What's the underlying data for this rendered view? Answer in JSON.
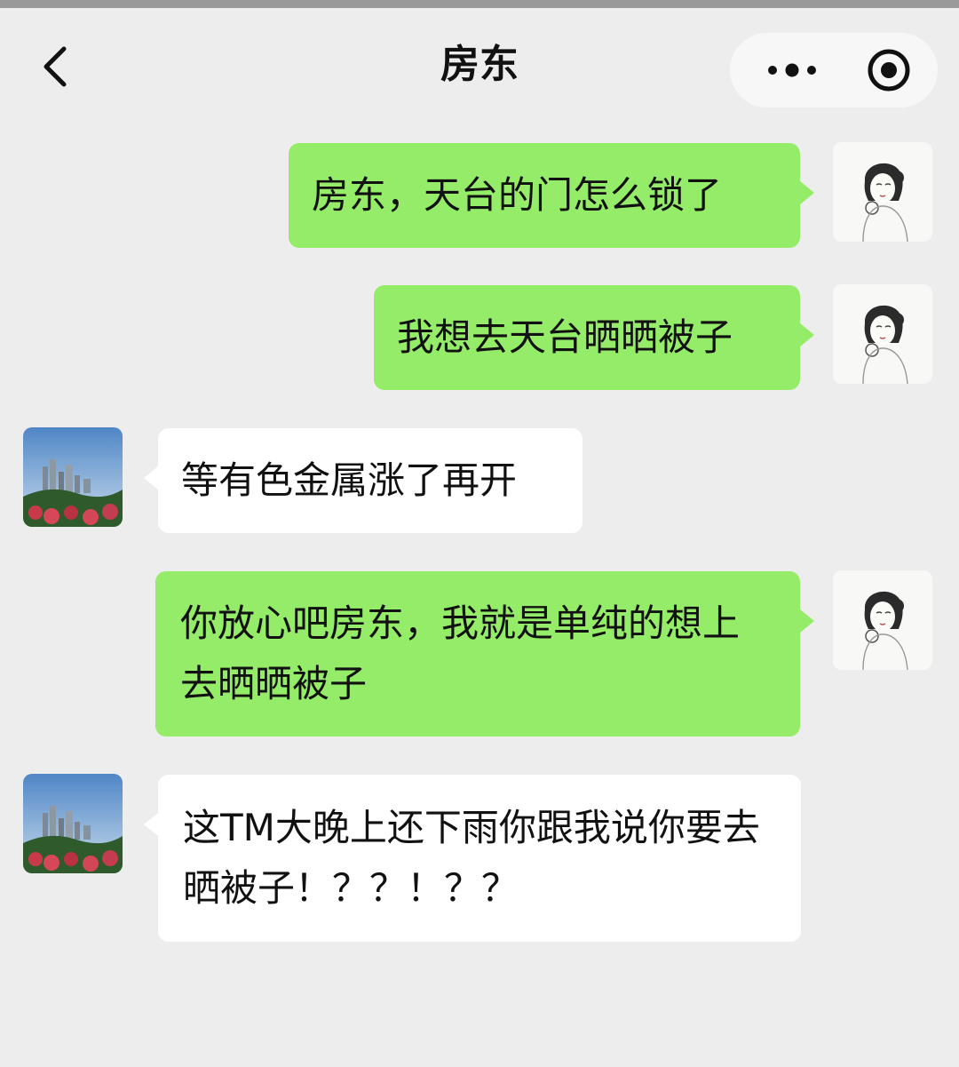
{
  "header": {
    "title": "房东",
    "back_icon": "chevron-left-icon",
    "more_icon": "more-dots-icon",
    "close_icon": "target-circle-icon"
  },
  "colors": {
    "background": "#ededed",
    "my_bubble": "#95ec69",
    "other_bubble": "#ffffff",
    "text": "#111111"
  },
  "messages": [
    {
      "sender": "me",
      "text": "房东，天台的门怎么锁了"
    },
    {
      "sender": "me",
      "text": "我想去天台晒晒被子"
    },
    {
      "sender": "landlord",
      "text": "等有色金属涨了再开"
    },
    {
      "sender": "me",
      "text": "你放心吧房东，我就是单纯的想上去晒晒被子"
    },
    {
      "sender": "landlord",
      "text": "这TM大晚上还下雨你跟我说你要去晒被子！？？！？？"
    }
  ]
}
